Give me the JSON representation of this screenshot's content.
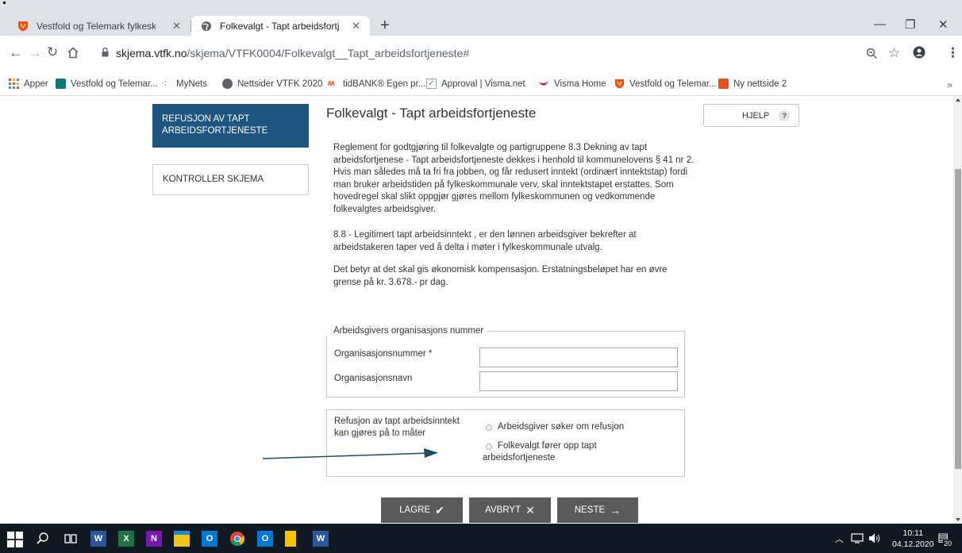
{
  "browser": {
    "tabs": [
      {
        "title": "Vestfold og Telemark fylkeskomm",
        "active": false
      },
      {
        "title": "Folkevalgt - Tapt arbeidsfortjenes",
        "active": true
      }
    ],
    "url_domain": "skjema.vtfk.no",
    "url_path": "/skjema/VTFK0004/Folkevalgt__Tapt_arbeidsfortjeneste#",
    "bookmarks": [
      "Apper",
      "Vestfold og Telemar...",
      "MyNets",
      "Nettsider VTFK 2020",
      "tidBANK® Egen pr...",
      "Approval | Visma.net",
      "Visma Home",
      "Vestfold og Telemar...",
      "Ny nettside 2"
    ]
  },
  "steps": [
    {
      "label": "REFUSJON AV TAPT ARBEIDSFORTJENESTE",
      "active": true
    },
    {
      "label": "KONTROLLER SKJEMA",
      "active": false
    }
  ],
  "form": {
    "title": "Folkevalgt - Tapt arbeidsfortjeneste",
    "help_label": "HJELP",
    "help_icon": "?",
    "paragraphs": [
      "Reglement for godtgjøring til folkevalgte og partigruppene 8.3 Dekning av tapt arbeidsfortjenese - Tapt arbeidsfortjeneste dekkes i henhold til kommunelovens § 41 nr 2. Hvis man således må ta fri fra jobben, og får redusert inntekt (ordinært inntektstap) fordi man bruker arbeidstiden på fylkeskommunale verv, skal inntektstapet erstattes. Som hovedregel skal slikt oppgjør gjøres mellom fylkeskommunen og vedkommende folkevalgtes arbeidsgiver.",
      "8.8 - Legitimert tapt arbeidsinntekt , er den lønnen arbeidsgiver bekrefter at arbeidstakeren taper ved å delta i møter i fylkeskommunale utvalg.",
      "Det betyr at det skal gis økonomisk kompensasjon. Erstatningsbeløpet har en øvre grense på kr. 3.678.- pr dag."
    ],
    "employer_legend": "Arbeidsgivers organisasjons nummer",
    "org_number_label": "Organisasjonsnummer *",
    "org_number_value": "",
    "org_name_label": "Organisasjonsnavn",
    "org_name_value": "",
    "refund_question": "Refusjon av tapt arbeidsinntekt kan gjøres på to måter",
    "refund_options": [
      "Arbeidsgiver søker om refusjon",
      "Folkevalgt fører opp tapt arbeidsfortjeneste"
    ],
    "buttons": {
      "save": "LAGRE",
      "cancel": "AVBRYT",
      "next": "NESTE"
    }
  },
  "taskbar": {
    "time": "10:11",
    "date": "04.12.2020",
    "notifications": "20"
  }
}
